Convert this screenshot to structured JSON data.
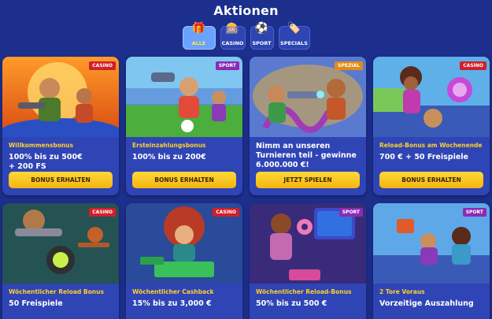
{
  "page": {
    "title": "Aktionen"
  },
  "tabs": [
    {
      "label": "ALLE",
      "icon": "gift-icon",
      "active": true
    },
    {
      "label": "CASINO",
      "icon": "slot-icon",
      "active": false
    },
    {
      "label": "SPORT",
      "icon": "ball-icon",
      "active": false
    },
    {
      "label": "SPECIALS",
      "icon": "tag-icon",
      "active": false
    }
  ],
  "cards": [
    {
      "badge": "CASINO",
      "sub": "Willkommensbonus",
      "main": "100% bis zu 500€\n+ 200 FS",
      "button": "BONUS ERHALTEN"
    },
    {
      "badge": "SPORT",
      "sub": "Ersteinzahlungsbonus",
      "main": "100% bis zu 200€",
      "button": "BONUS ERHALTEN"
    },
    {
      "badge": "SPEZIAL",
      "sub": "",
      "main": "Nimm an unseren\nTurnieren teil - gewinne\n6.000.000 €!",
      "button": "JETZT SPIELEN"
    },
    {
      "badge": "CASINO",
      "sub": "Reload-Bonus am Wochenende",
      "main": "700 € + 50 Freispiele",
      "button": "BONUS ERHALTEN"
    },
    {
      "badge": "CASINO",
      "sub": "Wöchentlicher Reload Bonus",
      "main": "50 Freispiele",
      "button": ""
    },
    {
      "badge": "CASINO",
      "sub": "Wöchentlicher Cashback",
      "main": "15% bis zu 3,000 €",
      "button": ""
    },
    {
      "badge": "SPORT",
      "sub": "Wöchentlicher Reload-Bonus",
      "main": "50% bis zu 500 €",
      "button": ""
    },
    {
      "badge": "SPORT",
      "sub": "2 Tore Voraus",
      "main": "Vorzeitige Auszahlung",
      "button": ""
    }
  ],
  "colors": {
    "background": "#1c2f8c",
    "card": "#2f44b5",
    "accent": "#ffd12a",
    "casino": "#d0202a",
    "sport": "#8a2bb6",
    "spezial": "#e28a16"
  }
}
